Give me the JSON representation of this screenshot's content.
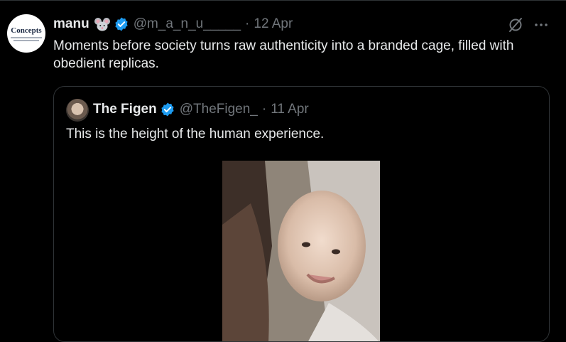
{
  "tweet": {
    "author_name": "manu",
    "author_emoji": "mouse-emoji",
    "handle": "@m_a_n_u_____",
    "separator": "·",
    "date": "12 Apr",
    "text": "Moments before society turns raw authenticity into a branded cage, filled with obedient replicas.",
    "avatar_logo_text": "Concepts"
  },
  "quoted": {
    "author_name": "The Figen",
    "handle": "@TheFigen_",
    "separator": "·",
    "date": "11 Apr",
    "text": "This is the height of the human experience."
  },
  "colors": {
    "background": "#000000",
    "text": "#e7e9ea",
    "muted": "#71767b",
    "border": "#2f3336",
    "verified": "#1d9bf0"
  }
}
